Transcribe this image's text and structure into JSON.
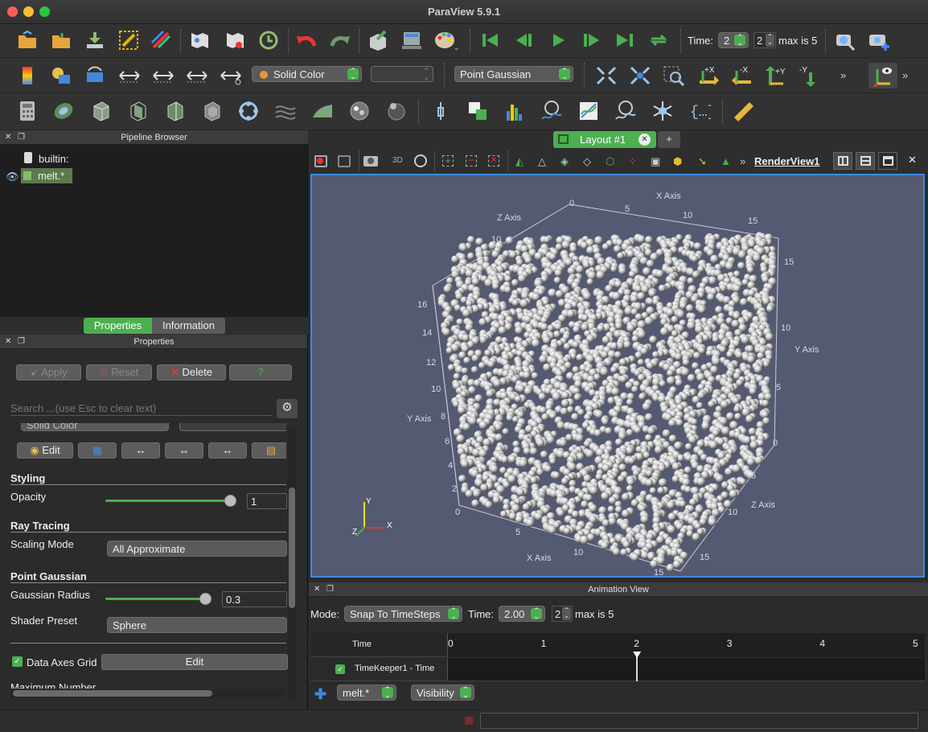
{
  "window": {
    "title": "ParaView 5.9.1"
  },
  "toolbar1": {
    "time_label": "Time:",
    "time_index": "2",
    "time_value": "2",
    "max_label": "max is 5",
    "icons": [
      "open-file-icon",
      "open-recent-icon",
      "load-data-icon",
      "connect-icon",
      "disconnect-icon",
      "manage-plugins-icon",
      "save-state-icon",
      "autoapply-icon",
      "undo-icon",
      "redo-icon",
      "find-data-icon",
      "spreadsheet-icon",
      "color-palette-icon",
      "first-frame-icon",
      "previous-frame-icon",
      "play-icon",
      "next-frame-icon",
      "last-frame-icon",
      "loop-icon",
      "zoom-to-data-icon",
      "screenshot-icon"
    ]
  },
  "toolbar2": {
    "color_by": "Solid Color",
    "component": "",
    "representation": "Point Gaussian",
    "camera_labels": [
      "+X",
      "-X",
      "+Y",
      "-Y"
    ]
  },
  "pipeline": {
    "header": "Pipeline Browser",
    "items": [
      {
        "label": "builtin:"
      },
      {
        "label": "melt.*"
      }
    ]
  },
  "tabs": {
    "properties": "Properties",
    "information": "Information"
  },
  "properties": {
    "header": "Properties",
    "apply": "Apply",
    "reset": "Reset",
    "delete": "Delete",
    "help": "?",
    "search_placeholder": "Search ...(use Esc to clear text)",
    "hidden_combo": "Solid Color",
    "edit": "Edit",
    "styling": "Styling",
    "opacity_label": "Opacity",
    "opacity_value": "1",
    "opacity_level": 1.0,
    "ray_tracing": "Ray Tracing",
    "scaling_mode_label": "Scaling Mode",
    "scaling_mode": "All Approximate",
    "point_gaussian": "Point Gaussian",
    "gaussian_radius_label": "Gaussian Radius",
    "gaussian_radius": "0.3",
    "shader_preset_label": "Shader Preset",
    "shader_preset": "Sphere",
    "data_axes_grid": "Data Axes Grid",
    "data_axes_edit": "Edit",
    "max_number": "Maximum Number"
  },
  "layout": {
    "tab": "Layout #1",
    "add": "+"
  },
  "renderview": {
    "name": "RenderView1",
    "mode3d": "3D"
  },
  "axes": {
    "x_title": "X Axis",
    "y_title": "Y Axis",
    "z_title": "Z Axis",
    "top_x": [
      "0",
      "5",
      "10",
      "15"
    ],
    "top_z": [
      "10"
    ],
    "right_y": [
      "15",
      "10",
      "5",
      "0"
    ],
    "left_y": [
      "16",
      "14",
      "12",
      "10",
      "8",
      "6",
      "4",
      "2",
      "0"
    ],
    "bottom_x": [
      "5",
      "10",
      "15"
    ],
    "bottom_z": [
      "5",
      "10",
      "15"
    ],
    "orientation": [
      "Y",
      "Z",
      "X"
    ]
  },
  "colors": {
    "view_bg": "#545a72",
    "accent": "#4caf50",
    "selection": "#3b8cdf"
  },
  "animation": {
    "header": "Animation View",
    "mode_label": "Mode:",
    "mode": "Snap To TimeSteps",
    "time_label": "Time:",
    "time_value": "2.00",
    "index": "2",
    "max_label": "max is 5",
    "col_time": "Time",
    "ticks": [
      "0",
      "1",
      "2",
      "3",
      "4",
      "5"
    ],
    "current_time": 2,
    "track": "TimeKeeper1 - Time",
    "source": "melt.*",
    "property": "Visibility"
  }
}
